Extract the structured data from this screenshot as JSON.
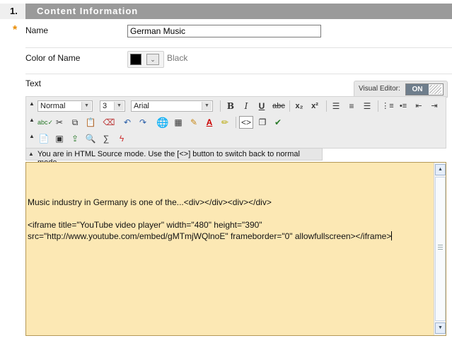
{
  "section": {
    "number": "1.",
    "title": "Content Information"
  },
  "fields": {
    "name": {
      "required_mark": "*",
      "label": "Name",
      "value": "German Music"
    },
    "color": {
      "label": "Color of Name",
      "swatch_color": "#000000",
      "value_label": "Black"
    },
    "text": {
      "label": "Text"
    }
  },
  "visual_editor": {
    "label": "Visual Editor:",
    "state": "ON"
  },
  "toolbar": {
    "format_select": "Normal",
    "size_select": "3",
    "font_select": "Arial",
    "buttons_row1": [
      "bold-icon",
      "italic-icon",
      "underline-icon",
      "strikethrough-icon",
      "subscript-icon",
      "superscript-icon",
      "align-left-icon",
      "align-center-icon",
      "align-right-icon",
      "ordered-list-icon",
      "unordered-list-icon",
      "outdent-icon",
      "indent-icon"
    ],
    "buttons_row2": [
      "spellcheck-icon",
      "cut-icon",
      "copy-icon",
      "paste-icon",
      "eraser-icon",
      "undo-icon",
      "redo-icon",
      "link-icon",
      "table-icon",
      "pencil-icon",
      "text-color-icon",
      "highlight-icon",
      "html-source-icon",
      "preview-icon",
      "check-icon"
    ],
    "buttons_row3": [
      "paste-word-icon",
      "image-icon",
      "attach-file-icon",
      "find-icon",
      "equation-icon",
      "flash-icon"
    ]
  },
  "status": {
    "message": "You are in HTML Source mode. Use the [<>] button to switch back to normal mode."
  },
  "editor": {
    "line1": "Music industry in Germany is one of the...<div></div><div></div>",
    "line2": "<iframe title=\"YouTube video player\" width=\"480\" height=\"390\"",
    "line3": "src=\"http://www.youtube.com/embed/gMTmjWQlnoE\" frameborder=\"0\" allowfullscreen></iframe>"
  },
  "colors": {
    "header_bg": "#9a9a9a",
    "required": "#e98a00",
    "editor_bg": "#fce8b4"
  }
}
